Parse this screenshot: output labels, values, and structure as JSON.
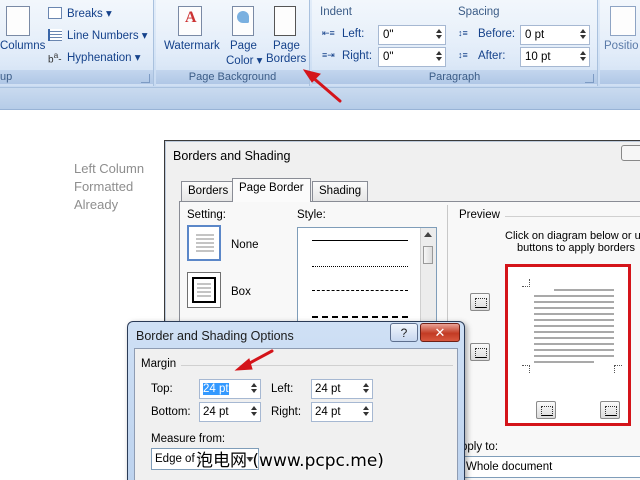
{
  "ribbon": {
    "columns_label": "Columns",
    "breaks_label": "Breaks",
    "line_numbers_label": "Line Numbers",
    "hyphenation_label": "Hyphenation",
    "setup_group_caption": "up",
    "watermark_label": "Watermark",
    "page_color_label_1": "Page",
    "page_color_label_2": "Color",
    "page_borders_label_1": "Page",
    "page_borders_label_2": "Borders",
    "page_background_caption": "Page Background",
    "indent_header": "Indent",
    "indent_left_label": "Left:",
    "indent_left_value": "0\"",
    "indent_right_label": "Right:",
    "indent_right_value": "0\"",
    "spacing_header": "Spacing",
    "spacing_before_label": "Before:",
    "spacing_before_value": "0 pt",
    "spacing_after_label": "After:",
    "spacing_after_value": "10 pt",
    "paragraph_caption": "Paragraph",
    "position_label": "Positio"
  },
  "document": {
    "text_line_1": "Left Column",
    "text_line_2": "Formatted",
    "text_line_3": "Already"
  },
  "borders_dialog": {
    "title": "Borders and Shading",
    "tabs": [
      "Borders",
      "Page Border",
      "Shading"
    ],
    "active_tab": "Page Border",
    "setting_label": "Setting:",
    "setting_none": "None",
    "setting_box": "Box",
    "style_label": "Style:",
    "preview_label": "Preview",
    "preview_hint_1": "Click on diagram below or us",
    "preview_hint_2": "buttons to apply borders",
    "apply_to_label": "pply to:",
    "apply_to_value": "Whole document"
  },
  "options_dialog": {
    "title": "Border and Shading Options",
    "help_label": "?",
    "close_label": "✕",
    "margin_label": "Margin",
    "top_label": "Top:",
    "top_value": "24 pt",
    "left_label": "Left:",
    "left_value": "24 pt",
    "bottom_label": "Bottom:",
    "bottom_value": "24 pt",
    "right_label": "Right:",
    "right_value": "24 pt",
    "measure_from_label": "Measure from:",
    "measure_from_value": "Edge of p"
  },
  "watermark_text": "泡电网 (www.pcpc.me)",
  "colors": {
    "annotation_red": "#d4141a",
    "ribbon_text": "#15428b",
    "selection_blue": "#3399ff"
  }
}
